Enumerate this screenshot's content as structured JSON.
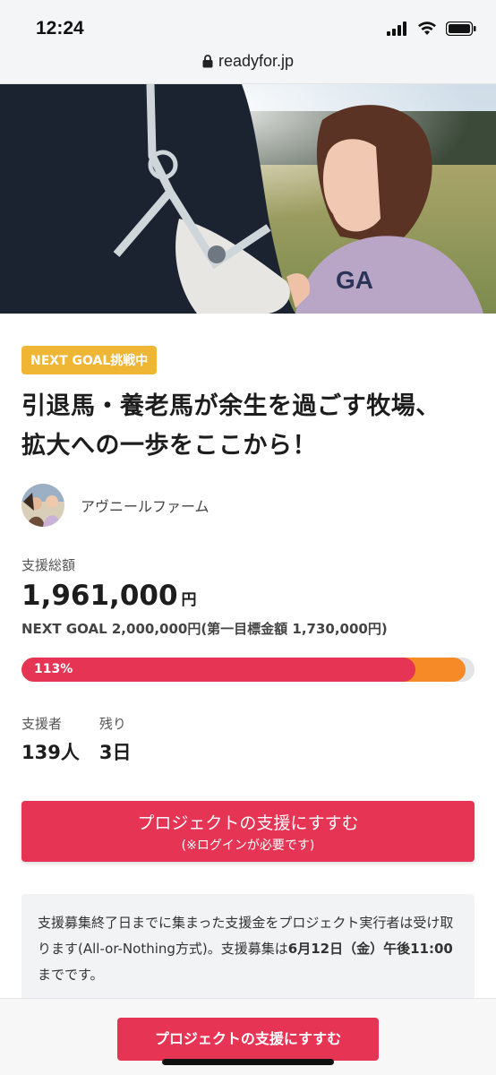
{
  "status_bar": {
    "time": "12:24"
  },
  "browser": {
    "url": "readyfor.jp"
  },
  "project": {
    "badge": "NEXT GOAL挑戦中",
    "title_line1": "引退馬・養老馬が余生を過ごす牧場、",
    "title_line2": "拡大への一歩をここから！",
    "owner_name": "アヴニールファーム"
  },
  "funding": {
    "total_label": "支援総額",
    "total_amount": "1,961,000",
    "total_unit": "円",
    "next_goal_text": "NEXT GOAL 2,000,000円(第一目標金額 1,730,000円)",
    "progress_label": "113%",
    "progress_first_goal_percent": 113,
    "progress_next_goal_percent": 98
  },
  "stats": {
    "supporters_label": "支援者",
    "supporters_value": "139人",
    "remaining_label": "残り",
    "remaining_value": "3日"
  },
  "cta": {
    "line1": "プロジェクトの支援にすすむ",
    "line2": "(※ログインが必要です)"
  },
  "note": {
    "text_part1": "支援募集終了日までに集まった支援金をプロジェクト実行者は受け取ります(All-or-Nothing方式)。支援募集は",
    "text_bold": "6月12日（金）午後11:00",
    "text_part2": "までです。"
  },
  "bottom_bar": {
    "cta_label": "プロジェクトの支援にすすむ"
  },
  "colors": {
    "accent": "#e63454",
    "badge": "#efb535",
    "progress_secondary": "#f68a26"
  }
}
